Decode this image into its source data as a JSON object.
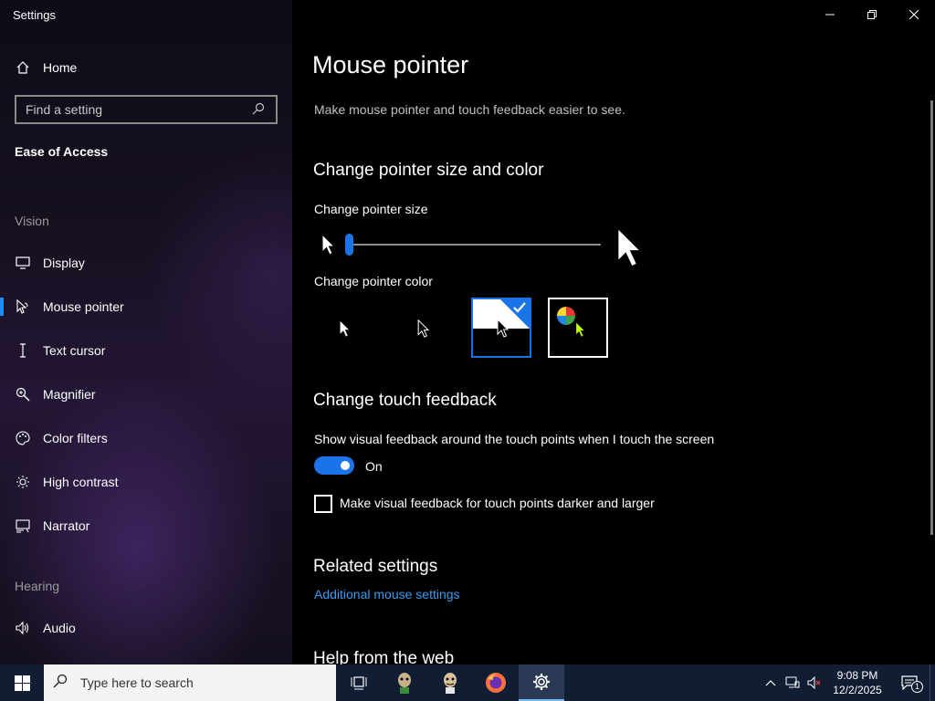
{
  "window": {
    "title": "Settings",
    "controls": {
      "minimize": "—",
      "restore": "❐",
      "close": "✕"
    }
  },
  "sidebar": {
    "home_label": "Home",
    "search_placeholder": "Find a setting",
    "section_title": "Ease of Access",
    "groups": [
      {
        "label": "Vision"
      },
      {
        "label": "Hearing"
      }
    ],
    "items": [
      {
        "label": "Display",
        "icon": "display-icon"
      },
      {
        "label": "Mouse pointer",
        "icon": "mouse-pointer-icon",
        "selected": true
      },
      {
        "label": "Text cursor",
        "icon": "text-cursor-icon"
      },
      {
        "label": "Magnifier",
        "icon": "magnifier-icon"
      },
      {
        "label": "Color filters",
        "icon": "color-filters-icon"
      },
      {
        "label": "High contrast",
        "icon": "high-contrast-icon"
      },
      {
        "label": "Narrator",
        "icon": "narrator-icon"
      },
      {
        "label": "Audio",
        "icon": "audio-icon"
      }
    ]
  },
  "main": {
    "title": "Mouse pointer",
    "description": "Make mouse pointer and touch feedback easier to see.",
    "size_color_heading": "Change pointer size and color",
    "pointer_size_label": "Change pointer size",
    "pointer_size_value": 1,
    "pointer_color_label": "Change pointer color",
    "pointer_colors": [
      "white",
      "black",
      "inverted",
      "custom"
    ],
    "pointer_color_selected": "inverted",
    "touch_heading": "Change touch feedback",
    "touch_show_label": "Show visual feedback around the touch points when I touch the screen",
    "touch_toggle_state": "On",
    "touch_darker_label": "Make visual feedback for touch points darker and larger",
    "related_heading": "Related settings",
    "related_link": "Additional mouse settings",
    "help_heading": "Help from the web"
  },
  "taskbar": {
    "search_placeholder": "Type here to search",
    "time": "9:08 PM",
    "date": "12/2/2025",
    "notification_count": "1",
    "accent": "#1a73e8"
  }
}
